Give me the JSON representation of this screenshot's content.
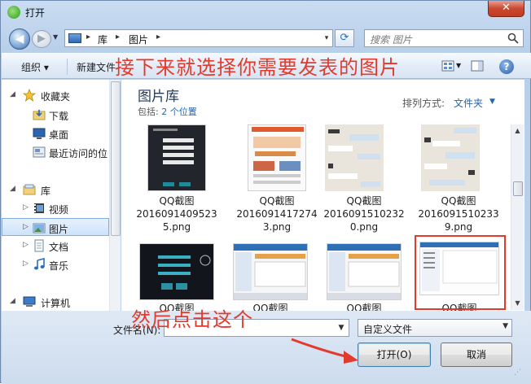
{
  "window": {
    "title": "打开",
    "close_glyph": "✕"
  },
  "address": {
    "crumbs": [
      "库",
      "图片"
    ],
    "sep": "▸",
    "drop": "▾"
  },
  "search": {
    "placeholder": "搜索 图片"
  },
  "toolbar": {
    "organize": "组织 ▾",
    "new_folder": "新建文件"
  },
  "sidebar": {
    "items": [
      {
        "label": "收藏夹",
        "icon": "star-icon"
      },
      {
        "label": "下载",
        "icon": "download-folder-icon"
      },
      {
        "label": "桌面",
        "icon": "desktop-icon"
      },
      {
        "label": "最近访问的位",
        "icon": "recent-places-icon"
      },
      {
        "label": "库",
        "icon": "library-icon"
      },
      {
        "label": "视频",
        "icon": "video-icon"
      },
      {
        "label": "图片",
        "icon": "pictures-icon"
      },
      {
        "label": "文档",
        "icon": "documents-icon"
      },
      {
        "label": "音乐",
        "icon": "music-icon"
      },
      {
        "label": "计算机",
        "icon": "computer-icon"
      }
    ]
  },
  "library": {
    "title": "图片库",
    "includes_prefix": "包括:",
    "includes_link": "2 个位置",
    "arrange_label": "排列方式:",
    "arrange_value": "文件夹"
  },
  "files": [
    {
      "line1": "QQ截图",
      "line2": "2016091409523",
      "line3": "5.png"
    },
    {
      "line1": "QQ截图",
      "line2": "2016091417274",
      "line3": "3.png"
    },
    {
      "line1": "QQ截图",
      "line2": "2016091510232",
      "line3": "0.png"
    },
    {
      "line1": "QQ截图",
      "line2": "2016091510233",
      "line3": "9.png"
    },
    {
      "line1": "QQ截图",
      "line2": "",
      "line3": ""
    },
    {
      "line1": "QQ截图",
      "line2": "",
      "line3": ""
    },
    {
      "line1": "QQ截图",
      "line2": "",
      "line3": ""
    },
    {
      "line1": "QQ截图",
      "line2": "",
      "line3": ""
    }
  ],
  "bottom": {
    "filename_label": "文件名(N):",
    "filename_value": "",
    "filetype": "自定义文件",
    "open_label": "打开(O)",
    "cancel_label": "取消"
  },
  "annotations": {
    "top": "接下来就选择你需要发表的图片",
    "bottom": "然后点击这个"
  },
  "colors": {
    "annotation": "#e23b2e",
    "link": "#1f66b5"
  }
}
